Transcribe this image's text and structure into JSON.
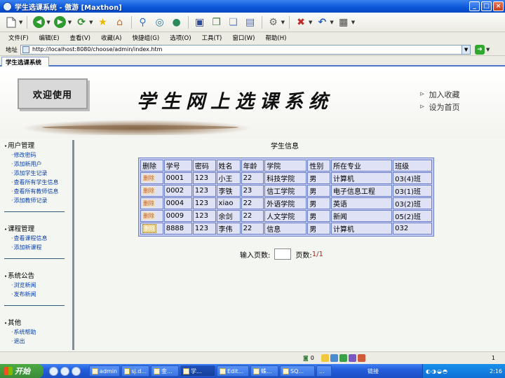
{
  "window": {
    "title": "学生选课系统 - 傲游 [Maxthon]",
    "controls": [
      "_",
      "□",
      "×"
    ]
  },
  "menu": [
    "文件(F)",
    "编辑(E)",
    "查看(V)",
    "收藏(A)",
    "快捷组(G)",
    "选项(O)",
    "工具(T)",
    "窗口(W)",
    "帮助(H)"
  ],
  "address": {
    "label": "地址",
    "url": "http://localhost:8080/choose/admin/index.htm"
  },
  "tab": {
    "label": "学生选课系统"
  },
  "banner": {
    "welcome": "欢迎使用",
    "title": "学生网上选课系统",
    "links": [
      "加入收藏",
      "设为首页"
    ]
  },
  "sidebar": [
    {
      "header": "用户管理",
      "links": [
        "修改密码",
        "添加新用户",
        "添加学生记录",
        "查看所有学生信息",
        "查看所有教师信息",
        "添加教师记录"
      ]
    },
    {
      "header": "课程管理",
      "links": [
        "查看课程信息",
        "添加新课程"
      ]
    },
    {
      "header": "系统公告",
      "links": [
        "浏览新闻",
        "发布新闻"
      ]
    },
    {
      "header": "其他",
      "links": [
        "系统帮助",
        "退出"
      ]
    }
  ],
  "main": {
    "title": "学生信息",
    "columns": [
      "删除",
      "学号",
      "密码",
      "姓名",
      "年龄",
      "学院",
      "性别",
      "所在专业",
      "班级"
    ],
    "delete_label": "删除",
    "rows": [
      [
        "0001",
        "123",
        "小王",
        "22",
        "科技学院",
        "男",
        "计算机",
        "03(4)班"
      ],
      [
        "0002",
        "123",
        "李铁",
        "23",
        "信工学院",
        "男",
        "电子信息工程",
        "03(1)班"
      ],
      [
        "0004",
        "123",
        "xiao",
        "22",
        "外语学院",
        "男",
        "英语",
        "03(2)班"
      ],
      [
        "0009",
        "123",
        "余剑",
        "22",
        "人文学院",
        "男",
        "新闻",
        "05(2)班"
      ],
      [
        "8888",
        "123",
        "李伟",
        "22",
        "信息",
        "男",
        "计算机",
        "032"
      ]
    ],
    "pager": {
      "input_label": "输入页数:",
      "pages_label": "页数:",
      "pages_value": "1/1"
    }
  },
  "statusbar": {
    "count": "0",
    "mem": "1"
  },
  "taskbar": {
    "start": "开始",
    "tasks": [
      "admin",
      "sj.d...",
      "金...",
      "学...",
      "Edit...",
      "蛛...",
      "SQ...",
      "..."
    ],
    "links": "链接",
    "clock": "2:16"
  }
}
